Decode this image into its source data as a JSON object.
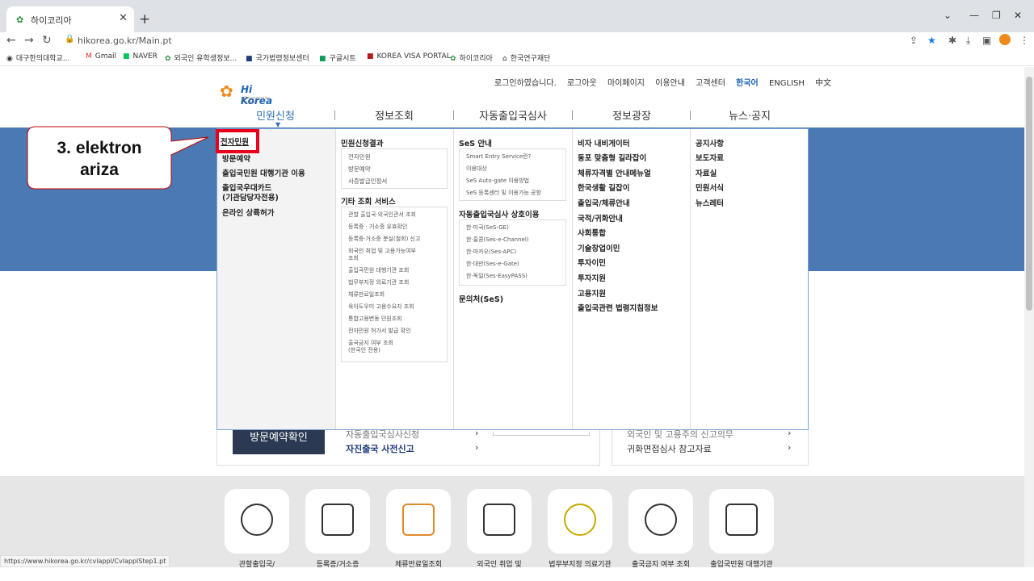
{
  "browser": {
    "tab_title": "하이코리아",
    "url": "hikorea.go.kr/Main.pt",
    "status_url": "https://www.hikorea.go.kr/cvlappl/CvlapplStep1.pt",
    "bookmarks": [
      "대구한의대학교...",
      "Gmail",
      "NAVER",
      "외국인 유학생정보...",
      "국가법령정보센터",
      "구글시트",
      "KOREA VISA PORTAL",
      "하이코리아",
      "한국연구재단"
    ]
  },
  "site": {
    "logo_text": "Hi Korea",
    "logo_sub": "e-Government for Foreigners",
    "util_nav": [
      "로그인하였습니다.",
      "로그아웃",
      "마이페이지",
      "이용안내",
      "고객센터"
    ],
    "languages": [
      "한국어",
      "ENGLISH",
      "中文"
    ],
    "gnb": [
      "민원신청",
      "정보조회",
      "자동출입국심사",
      "정보광장",
      "뉴스·공지"
    ]
  },
  "mega": {
    "col0": [
      "전자민원",
      "방문예약",
      "출입국민원 대행기관 이용",
      "출입국우대카드",
      "(기관담당자전용)",
      "온라인 상륙허가"
    ],
    "col1": {
      "h1": "민원신청결과",
      "items1": [
        "전자민원",
        "방문예약",
        "사증발급인정서"
      ],
      "h2": "기타 조회 서비스",
      "items2": [
        "관할 출입국·외국인관서 조회",
        "등록증 · 거소증 유효확인",
        "등록증·거소증 분실(철회) 신고",
        "외국인 취업 및 고용가능여부",
        "조회",
        "출입국민원 대행기관 조회",
        "법무부지정 의료기관 조회",
        "체류만료일조회",
        "육아도우미 고용수요자 조회",
        "통합고용변동 민원조회",
        "전자민원 허가서 발급 확인",
        "출국금지 여부 조회",
        "(한국인 전용)"
      ]
    },
    "col2": {
      "h1": "SeS 안내",
      "items1": [
        "Smart Entry Service란?",
        "이용대상",
        "SeS Auto-gate 이용방법",
        "SeS 등록센터 및 이용가능 공항"
      ],
      "h2": "자동출입국심사 상호이용",
      "items2": [
        "한·미국(SeS-GE)",
        "한·홍콩(Ses-e-Channel)",
        "한·마카오(Ses-APC)",
        "한·대만(Ses-e-Gate)",
        "한·독일(Ses-EasyPASS)"
      ],
      "h3": "문의처(SeS)"
    },
    "col3": [
      "비자 내비게이터",
      "동포 맞춤형 길라잡이",
      "체류자격별 안내메뉴얼",
      "한국생활 길잡이",
      "출입국/체류안내",
      "국적/귀화안내",
      "사회통합",
      "기술창업이민",
      "투자이민",
      "투자지원",
      "고용지원",
      "출입국관련 법령지침정보"
    ],
    "col4": [
      "공지사항",
      "보도자료",
      "자료실",
      "민원서식",
      "뉴스레터"
    ]
  },
  "panels": {
    "visit_button": "방문예약확인",
    "left_links": [
      "자동출입국심사신청",
      "자진출국 사전신고"
    ],
    "right_links": [
      "외국인 및 고용주의 신고의무",
      "귀화면접심사 참고자료"
    ]
  },
  "quick": [
    "관할출입국/",
    "등록증/거소증",
    "체류만료일조회",
    "외국인 취업 및",
    "법무부지정 의료기관",
    "출국금지 여부 조회",
    "출입국민원 대행기관"
  ],
  "callout": {
    "line1": "3. elektron",
    "line2": "ariza"
  },
  "colors": {
    "banner": "#4a79b3",
    "highlight": "#e8001c",
    "accent": "#2f6fb5"
  }
}
